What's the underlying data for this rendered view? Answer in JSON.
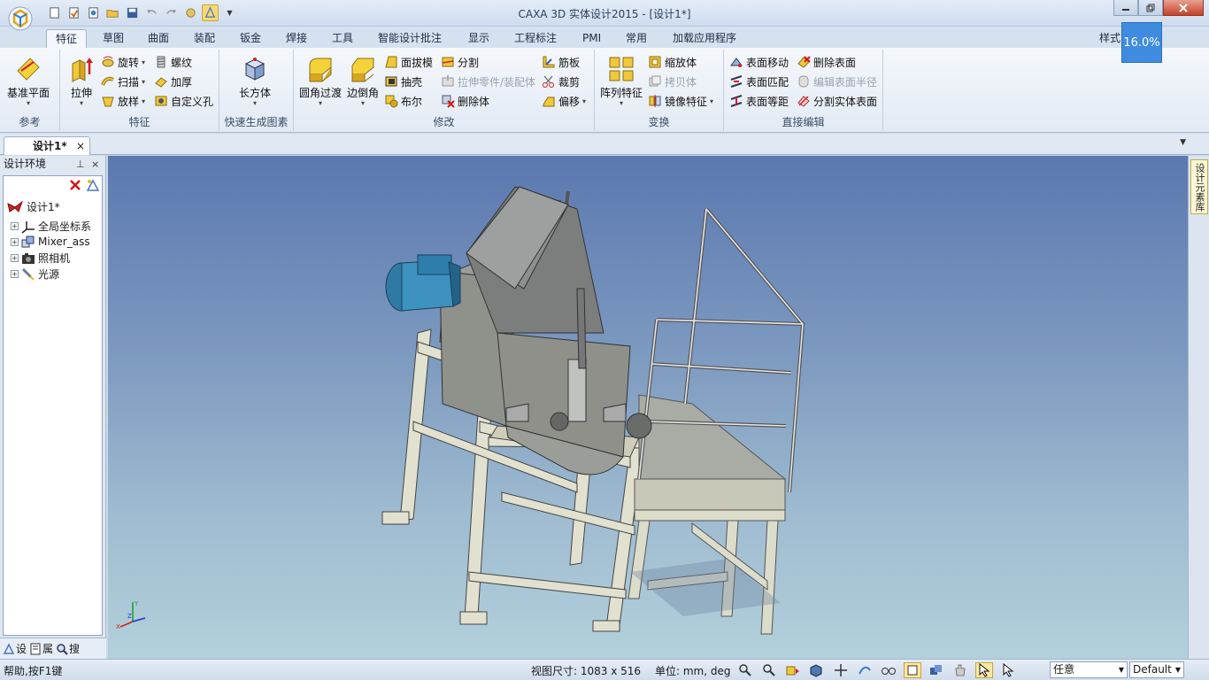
{
  "titlebar": {
    "title": "CAXA 3D 实体设计2015 - [设计1*]",
    "qat_dropdown": "▼"
  },
  "tabs": [
    {
      "label": "特征",
      "active": true
    },
    {
      "label": "草图"
    },
    {
      "label": "曲面"
    },
    {
      "label": "装配"
    },
    {
      "label": "钣金"
    },
    {
      "label": "焊接"
    },
    {
      "label": "工具"
    },
    {
      "label": "智能设计批注"
    },
    {
      "label": "显示"
    },
    {
      "label": "工程标注"
    },
    {
      "label": "PMI"
    },
    {
      "label": "常用"
    },
    {
      "label": "加载应用程序"
    }
  ],
  "style_label": "样式",
  "zoom_badge": "16.0%",
  "ribbon": {
    "reference": {
      "label": "参考",
      "datum_plane": "基准平面"
    },
    "feature": {
      "label": "特征",
      "extrude": "拉伸",
      "revolve": "旋转",
      "sweep": "扫描",
      "loft": "放样",
      "thread": "螺纹",
      "thicken": "加厚",
      "custom_hole": "自定义孔"
    },
    "quick": {
      "label": "快速生成图素",
      "box": "长方体"
    },
    "modify": {
      "label": "修改",
      "fillet": "圆角过渡",
      "chamfer": "边倒角",
      "face_draft": "面拔模",
      "shell": "抽壳",
      "boolean": "布尔",
      "split": "分割",
      "stretch_part": "拉伸零件/装配体",
      "delete_body": "删除体",
      "rib": "筋板",
      "trim": "裁剪",
      "offset": "偏移"
    },
    "transform": {
      "label": "变换",
      "pattern": "阵列特征",
      "scale": "缩放体",
      "copy_body": "拷贝体",
      "mirror": "镜像特征"
    },
    "direct_edit": {
      "label": "直接编辑",
      "move_face": "表面移动",
      "match_face": "表面匹配",
      "offset_face": "表面等距",
      "delete_face": "删除表面",
      "edit_face_radius": "编辑表面半径",
      "split_solid_face": "分割实体表面"
    }
  },
  "doc_tab": {
    "title": "设计1*",
    "close": "×"
  },
  "panel": {
    "title": "设计环境",
    "pin": "ᵖ",
    "close": "×",
    "root": "设计1*",
    "items": [
      "全局坐标系",
      "Mixer_ass",
      "照相机",
      "光源"
    ],
    "bottom_tabs": [
      "设",
      "属",
      "搜"
    ]
  },
  "right_strip": {
    "label": "设计元素库"
  },
  "status": {
    "help": "帮助,按F1键",
    "view_size": "视图尺寸: 1083 x 516",
    "units": "单位: mm, deg",
    "select_mode": "任意",
    "render_style": "Default"
  },
  "colors": {
    "accent_blue": "#3f8be0",
    "viewport_top": "#5b78b0",
    "viewport_bottom": "#b3d0dc"
  }
}
